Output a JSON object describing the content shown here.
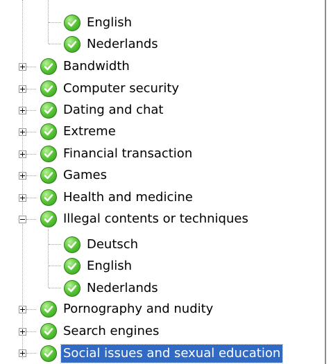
{
  "tree": {
    "top_children": [
      {
        "label": "English"
      },
      {
        "label": "Nederlands"
      }
    ],
    "categories": [
      {
        "label": "Bandwidth"
      },
      {
        "label": "Computer security"
      },
      {
        "label": "Dating and chat"
      },
      {
        "label": "Extreme"
      },
      {
        "label": "Financial transaction"
      },
      {
        "label": "Games"
      },
      {
        "label": "Health and medicine"
      },
      {
        "label": "Illegal contents or techniques",
        "expanded": true
      },
      {
        "label": "Pornography and nudity"
      },
      {
        "label": "Search engines"
      },
      {
        "label": "Social issues and sexual education",
        "selected": true
      }
    ],
    "illegal_children": [
      {
        "label": "Deutsch"
      },
      {
        "label": "English"
      },
      {
        "label": "Nederlands"
      }
    ],
    "status_icon": "green-check-circle-icon",
    "selection_color": "#316ac5"
  }
}
